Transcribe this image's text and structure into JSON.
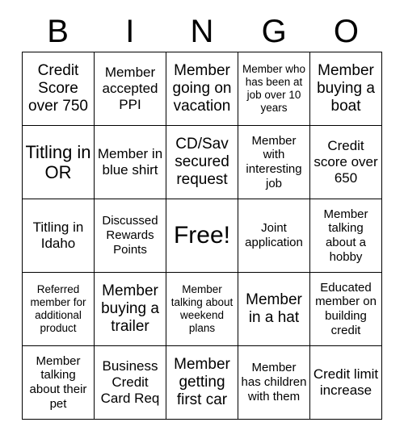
{
  "header": {
    "letters": [
      "B",
      "I",
      "N",
      "G",
      "O"
    ]
  },
  "grid": {
    "columns": 5,
    "rows": 5,
    "free_space_index": 12,
    "border_color": "#000000",
    "background_color": "#ffffff",
    "text_color": "#000000",
    "cells": [
      {
        "text": "Credit Score over 750",
        "size": "lg"
      },
      {
        "text": "Member accepted PPI",
        "size": "md"
      },
      {
        "text": "Member going on vacation",
        "size": "lg"
      },
      {
        "text": "Member who has been at job over 10 years",
        "size": "xs"
      },
      {
        "text": "Member buying a boat",
        "size": "lg"
      },
      {
        "text": "Titling in OR",
        "size": "xl"
      },
      {
        "text": "Member in blue shirt",
        "size": "md"
      },
      {
        "text": "CD/Sav secured request",
        "size": "lg"
      },
      {
        "text": "Member with interesting job",
        "size": "sm"
      },
      {
        "text": "Credit score over 650",
        "size": "md"
      },
      {
        "text": "Titling in Idaho",
        "size": "md"
      },
      {
        "text": "Discussed Rewards Points",
        "size": "sm"
      },
      {
        "text": "Free!",
        "size": "xxl"
      },
      {
        "text": "Joint application",
        "size": "sm"
      },
      {
        "text": "Member talking about a hobby",
        "size": "sm"
      },
      {
        "text": "Referred member for additional product",
        "size": "xs"
      },
      {
        "text": "Member buying a trailer",
        "size": "lg"
      },
      {
        "text": "Member talking about weekend plans",
        "size": "xs"
      },
      {
        "text": "Member in a hat",
        "size": "lg"
      },
      {
        "text": "Educated member on building credit",
        "size": "sm"
      },
      {
        "text": "Member talking about their pet",
        "size": "sm"
      },
      {
        "text": "Business Credit Card Req",
        "size": "md"
      },
      {
        "text": "Member getting first car",
        "size": "lg"
      },
      {
        "text": "Member has children with them",
        "size": "sm"
      },
      {
        "text": "Credit limit increase",
        "size": "md"
      }
    ]
  }
}
